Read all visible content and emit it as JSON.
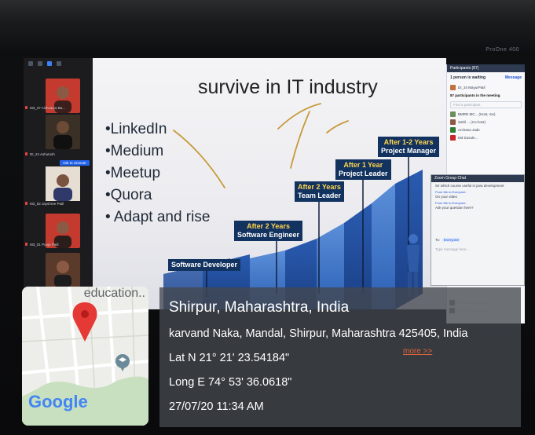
{
  "monitor": {
    "brand": "ProOne 400"
  },
  "zoom": {
    "participants": [
      {
        "name": "M3_37 Aishvarya Ba..."
      },
      {
        "name": "DI_24 Ashutosh"
      },
      {
        "name": "M3_52 Jayshree Patil"
      },
      {
        "name": "M3_01 Pooja Patil"
      }
    ],
    "tooltip": "Ask to Unmute"
  },
  "slide": {
    "title": "survive in IT industry",
    "bullets": [
      "•LinkedIn",
      "•Medium",
      "•Meetup",
      "•Quora",
      "• Adapt and rise"
    ],
    "steps": [
      {
        "title": "Software Developer"
      },
      {
        "year": "After 2 Years",
        "title": "Software Engineer"
      },
      {
        "year": "After 2 Years",
        "title": "Team Leader"
      },
      {
        "year": "After 1 Year",
        "title": "Project Leader"
      },
      {
        "year": "After 1-2 Years",
        "title": "Project Manager"
      }
    ]
  },
  "participants_panel": {
    "header": "Participants (87)",
    "waiting": "1 person is waiting",
    "message": "Message",
    "waiting_person": "DI_34 MayurPatil",
    "in_meeting": "87 participants in the meeting",
    "search_placeholder": "Find a participant",
    "rows": [
      "BMRD MC... (Host, me)",
      "Sahil ... (Co-host)",
      "Archana Jade",
      "M3 Dusule..."
    ],
    "bottom_rows": [
      "DI_1 Akash Rajput",
      "DI_16 Aishwarya Ku..."
    ]
  },
  "chat": {
    "header": "Zoom Group Chat",
    "messages": [
      {
        "from": "",
        "text": "Sir which course useful in java development"
      },
      {
        "from": "From Me to Everyone:",
        "text": "On your video"
      },
      {
        "from": "From Me to Everyone:",
        "text": "Ask your question here?"
      }
    ],
    "to_label": "To:",
    "to_value": "Everyone",
    "input_placeholder": "Type message here..."
  },
  "map": {
    "place_label": "education..",
    "logo": "Google"
  },
  "location": {
    "title": "Shirpur, Maharashtra, India",
    "address": "karvand Naka, Mandal, Shirpur, Maharashtra 425405, India",
    "lat": "Lat N 21° 21' 23.54184\"",
    "long": "Long E 74° 53' 36.0618\"",
    "datetime": "27/07/20 11:34 AM",
    "more": "more >>"
  }
}
